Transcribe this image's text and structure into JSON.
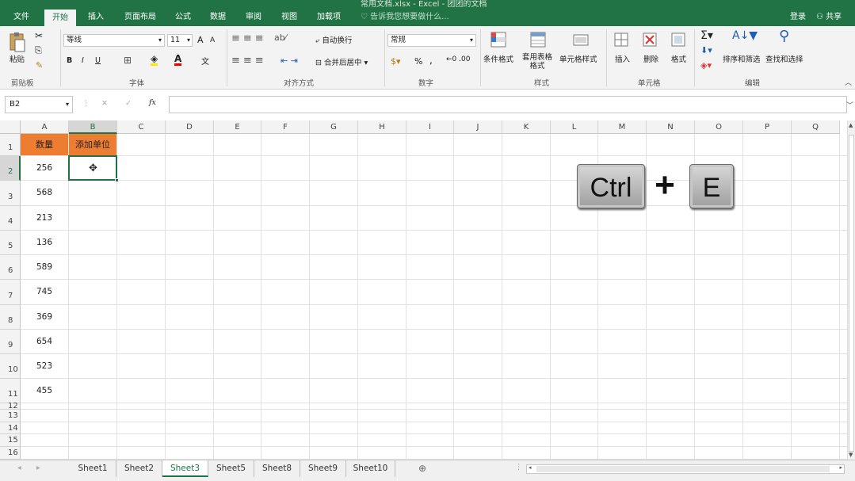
{
  "titlebar": {
    "title": "常用文档.xlsx - Excel - 团团的文档"
  },
  "tabs": [
    {
      "label": "文件"
    },
    {
      "label": "开始"
    },
    {
      "label": "插入"
    },
    {
      "label": "页面布局"
    },
    {
      "label": "公式"
    },
    {
      "label": "数据"
    },
    {
      "label": "审阅"
    },
    {
      "label": "视图"
    },
    {
      "label": "加载项"
    }
  ],
  "tellme": "告诉我您想要做什么...",
  "account": {
    "login": "登录",
    "share": "共享"
  },
  "ribbon": {
    "clipboard": {
      "paste": "粘贴",
      "label": "剪贴板"
    },
    "font": {
      "name": "等线",
      "size": "11",
      "label": "字体",
      "bold": "B",
      "italic": "I",
      "underline": "U",
      "grow": "A",
      "shrink": "A"
    },
    "alignment": {
      "wrap": "自动换行",
      "merge": "合并后居中",
      "label": "对齐方式"
    },
    "number": {
      "format": "常规",
      "percent": "%",
      "comma": ",",
      "label": "数字"
    },
    "styles": {
      "conditional": "条件格式",
      "table": "套用表格格式",
      "cell": "单元格样式",
      "label": "样式"
    },
    "cells": {
      "insert": "插入",
      "delete": "删除",
      "format": "格式",
      "label": "单元格"
    },
    "editing": {
      "sort": "排序和筛选",
      "find": "查找和选择",
      "label": "编辑"
    }
  },
  "formula_bar": {
    "name_box": "B2",
    "fx": "fx",
    "cancel": "✕",
    "confirm": "✓",
    "value": ""
  },
  "columns": [
    "A",
    "B",
    "C",
    "D",
    "E",
    "F",
    "G",
    "H",
    "I",
    "J",
    "K",
    "L",
    "M",
    "N",
    "O",
    "P",
    "Q"
  ],
  "rows": [
    "1",
    "2",
    "3",
    "4",
    "5",
    "6",
    "7",
    "8",
    "9",
    "10",
    "11",
    "12",
    "13",
    "14",
    "15",
    "16"
  ],
  "cells": {
    "A1": "数量",
    "B1": "添加单位",
    "A_values": [
      "256",
      "568",
      "213",
      "136",
      "589",
      "745",
      "369",
      "654",
      "523",
      "455"
    ]
  },
  "selected_cell": "B2",
  "shortcut": {
    "key1": "Ctrl",
    "plus": "+",
    "key2": "E"
  },
  "sheets": [
    "Sheet1",
    "Sheet2",
    "Sheet3",
    "Sheet5",
    "Sheet8",
    "Sheet9",
    "Sheet10"
  ],
  "active_sheet": "Sheet3",
  "colors": {
    "excel_green": "#217346",
    "header_orange": "#ED7D31"
  }
}
